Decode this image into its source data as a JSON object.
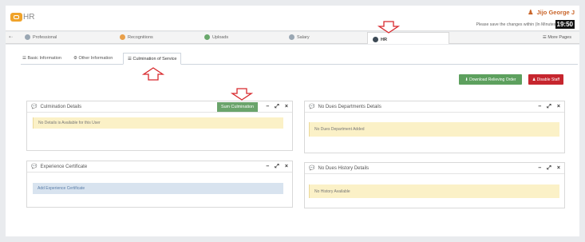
{
  "app": {
    "logo_text": "HR"
  },
  "user": {
    "name": "Jijo George J",
    "save_message": "Please save the changes within (In Minutes)",
    "timer": "19:50"
  },
  "module_tabs": [
    {
      "label": "Professional",
      "color": "#9aa7b3"
    },
    {
      "label": "Recognitions",
      "color": "#e9a04a"
    },
    {
      "label": "Uploads",
      "color": "#6aa86c"
    },
    {
      "label": "Salary",
      "color": "#9aa7b3"
    },
    {
      "label": "HR",
      "color": "#3d4a55"
    }
  ],
  "more_pages": "☰ More Pages",
  "sub_tabs": [
    {
      "label": "Basic Information",
      "icon": "list-icon"
    },
    {
      "label": "Other Information",
      "icon": "gear-icon"
    },
    {
      "label": "Culmination of Service",
      "icon": "list-icon"
    }
  ],
  "buttons": {
    "download": "Download Relieving Order",
    "disable": "Disable Staff",
    "sum_culmination": "Sum Culmination"
  },
  "panels": {
    "culmination": {
      "title": "Culmination Details",
      "message": "No Details is Available for this User"
    },
    "no_dues_dept": {
      "title": "No Dues Departments Details",
      "message": "No Dues Department Added"
    },
    "experience": {
      "title": "Experience Certificate",
      "message": "Add Experience Certificate"
    },
    "no_dues_history": {
      "title": "No Dues History Details",
      "message": "No History Available"
    }
  },
  "colors": {
    "green": "#5da05e",
    "red": "#c6262e",
    "alert_yellow": "#fbf1c7",
    "alert_blue": "#d8e3ef",
    "accent_orange": "#f0a32a"
  }
}
